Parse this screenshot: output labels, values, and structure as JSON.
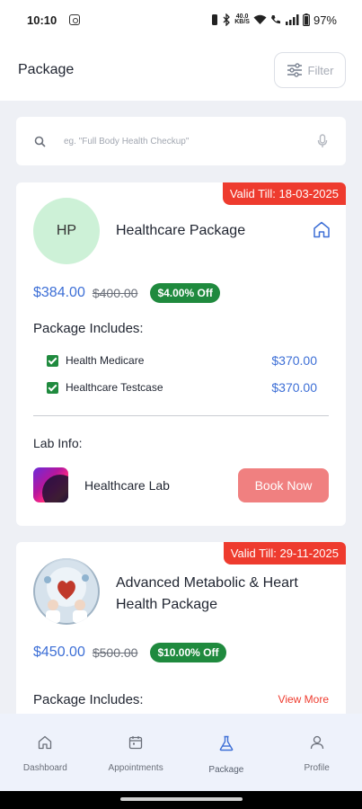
{
  "status_bar": {
    "time": "10:10",
    "net_top": "40.0",
    "net_bottom": "KB/S",
    "battery": "97%"
  },
  "header": {
    "title": "Package",
    "filter_label": "Filter"
  },
  "search": {
    "placeholder": "eg. \"Full Body Health Checkup\""
  },
  "packages": [
    {
      "valid_till": "Valid Till: 18-03-2025",
      "avatar_text": "HP",
      "name": "Healthcare Package",
      "price": "$384.00",
      "old_price": "$400.00",
      "discount": "$4.00% Off",
      "includes_label": "Package Includes:",
      "includes": [
        {
          "name": "Health Medicare",
          "amount": "$370.00"
        },
        {
          "name": "Healthcare Testcase",
          "amount": "$370.00"
        }
      ],
      "lab_info_label": "Lab Info:",
      "lab_name": "Healthcare Lab",
      "book_label": "Book Now"
    },
    {
      "valid_till": "Valid Till: 29-11-2025",
      "name": "Advanced Metabolic & Heart Health Package",
      "price": "$450.00",
      "old_price": "$500.00",
      "discount": "$10.00% Off",
      "includes_label": "Package Includes:",
      "view_more": "View More"
    }
  ],
  "nav": [
    {
      "label": "Dashboard",
      "icon": "home-icon"
    },
    {
      "label": "Appointments",
      "icon": "calendar-icon"
    },
    {
      "label": "Package",
      "icon": "flask-icon",
      "active": true
    },
    {
      "label": "Profile",
      "icon": "user-icon"
    }
  ],
  "colors": {
    "accent": "#3d6fd6",
    "tag_red": "#ee3b2e",
    "discount_green": "#1f8a3e",
    "book_button": "#f08080"
  }
}
